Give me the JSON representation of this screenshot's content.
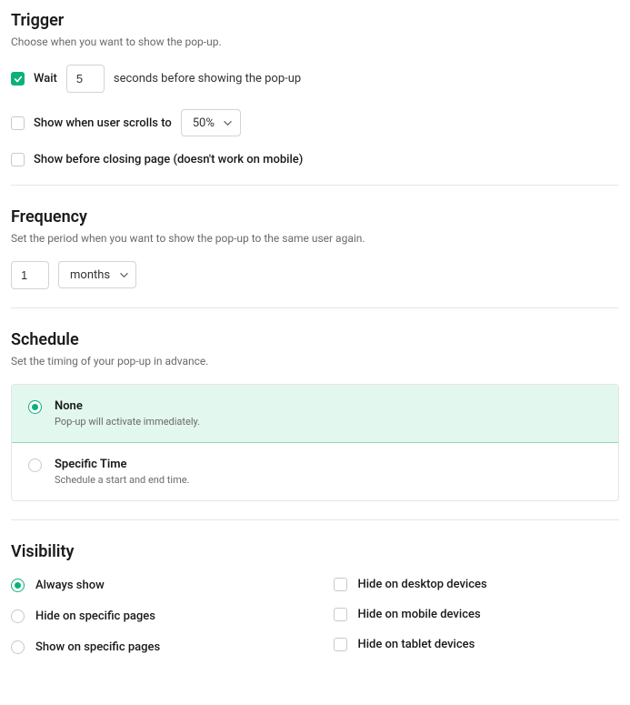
{
  "trigger": {
    "title": "Trigger",
    "desc": "Choose when you want to show the pop-up.",
    "wait": {
      "label": "Wait",
      "value": "5",
      "suffix": "seconds before showing the pop-up",
      "checked": true
    },
    "scroll": {
      "label": "Show when user scrolls to",
      "select": "50%",
      "checked": false
    },
    "close": {
      "label": "Show before closing page (doesn't work on mobile)",
      "checked": false
    }
  },
  "frequency": {
    "title": "Frequency",
    "desc": "Set the period when you want to show the pop-up to the same user again.",
    "value": "1",
    "unit": "months"
  },
  "schedule": {
    "title": "Schedule",
    "desc": "Set the timing of your pop-up in advance.",
    "options": [
      {
        "title": "None",
        "sub": "Pop-up will activate immediately.",
        "selected": true
      },
      {
        "title": "Specific Time",
        "sub": "Schedule a start and end time.",
        "selected": false
      }
    ]
  },
  "visibility": {
    "title": "Visibility",
    "left": [
      {
        "label": "Always show",
        "type": "radio",
        "checked": true
      },
      {
        "label": "Hide on specific pages",
        "type": "radio",
        "checked": false
      },
      {
        "label": "Show on specific pages",
        "type": "radio",
        "checked": false
      }
    ],
    "right": [
      {
        "label": "Hide on desktop devices",
        "type": "checkbox",
        "checked": false
      },
      {
        "label": "Hide on mobile devices",
        "type": "checkbox",
        "checked": false
      },
      {
        "label": "Hide on tablet devices",
        "type": "checkbox",
        "checked": false
      }
    ]
  }
}
